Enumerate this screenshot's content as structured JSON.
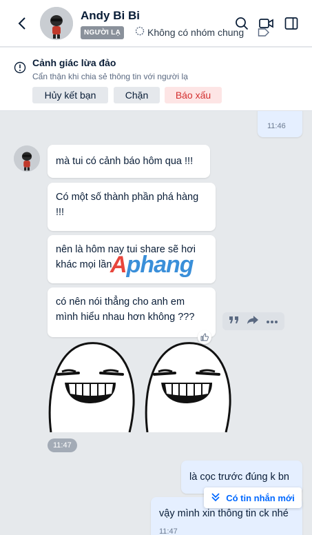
{
  "header": {
    "name": "Andy Bi Bi",
    "badge": "NGƯỜI LẠ",
    "groups": "Không có nhóm chung",
    "icons": [
      "back-arrow-icon",
      "search-icon",
      "video-call-icon",
      "sidebar-toggle-icon",
      "label-tag-icon",
      "group-icon"
    ]
  },
  "warning": {
    "title": "Cảnh giác lừa đảo",
    "subtitle": "Cẩn thận khi chia sẻ thông tin với người lạ",
    "buttons": {
      "unfriend": "Hủy kết bạn",
      "block": "Chặn",
      "report": "Báo xấu"
    }
  },
  "messages": {
    "my_first_time": "11:46",
    "incoming": [
      "mà tui có cảnh báo hôm qua !!!",
      "Có một số thành phần phá hàng !!!",
      "nên là hôm nay tui share sẽ hơi khác mọi lần",
      "có nên nói thẳng cho anh em mình hiểu nhau hơn không ???"
    ],
    "incoming_time": "11:47",
    "outgoing": [
      {
        "text": "là cọc trước đúng k bn"
      },
      {
        "text": "vậy mình xin thông tin ck nhé",
        "time": "11:47"
      }
    ]
  },
  "watermark": {
    "first": "A",
    "rest": "phang"
  },
  "new_messages_button": "Có tin nhắn mới",
  "colors": {
    "accent": "#0068ff",
    "danger": "#d32f2f",
    "chat_bg": "#e6e9ec",
    "my_bubble": "#e5efff"
  }
}
